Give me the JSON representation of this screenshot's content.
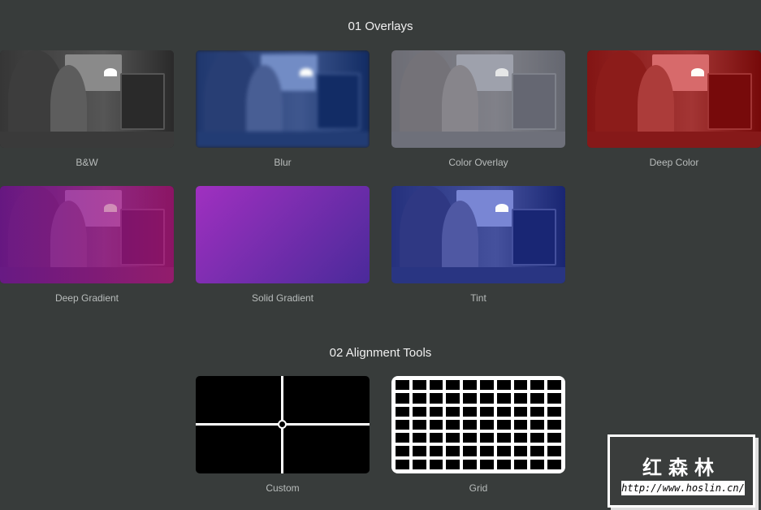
{
  "sections": [
    {
      "title": "01 Overlays",
      "items": [
        {
          "label": "B&W",
          "tint": "#6a6a6a",
          "filter": "grayscale(1)"
        },
        {
          "label": "Blur",
          "tint": "#3a5aa0",
          "filter": "blur(2px)"
        },
        {
          "label": "Color Overlay",
          "tint": "#b8bcc8",
          "filter": "none"
        },
        {
          "label": "Deep Color",
          "tint": "#a01818",
          "filter": "none"
        },
        {
          "label": "Deep Gradient",
          "tint": "#8a2aa0",
          "filter": "none"
        },
        {
          "label": "Solid Gradient",
          "tint": "#8a2ac0",
          "filter": "none"
        },
        {
          "label": "Tint",
          "tint": "#3040a0",
          "filter": "none"
        }
      ]
    },
    {
      "title": "02 Alignment Tools",
      "items": [
        {
          "label": "Custom"
        },
        {
          "label": "Grid"
        }
      ]
    }
  ],
  "watermark": {
    "name": "红森林",
    "url": "http://www.hoslin.cn/"
  }
}
